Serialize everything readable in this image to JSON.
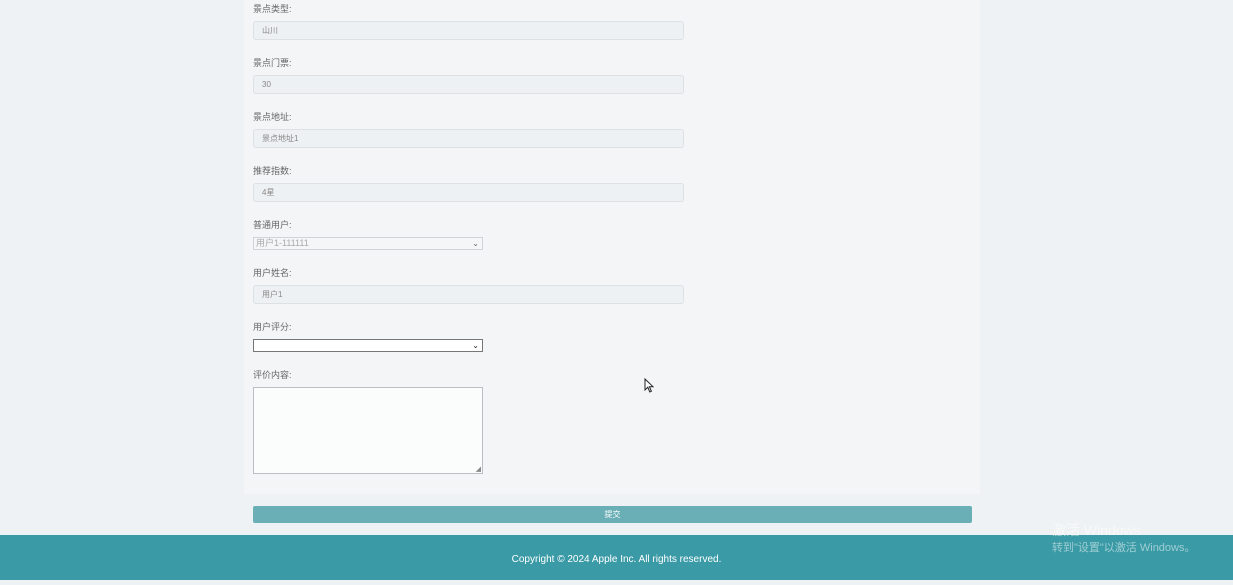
{
  "form": {
    "fields": [
      {
        "label": "景点类型:",
        "value": "山川"
      },
      {
        "label": "景点门票:",
        "value": "30"
      },
      {
        "label": "景点地址:",
        "value": "景点地址1"
      },
      {
        "label": "推荐指数:",
        "value": "4星"
      }
    ],
    "user_select": {
      "label": "普通用户:",
      "value": "用户1-111111"
    },
    "user_name": {
      "label": "用户姓名:",
      "value": "用户1"
    },
    "rating_select": {
      "label": "用户评分:",
      "value": ""
    },
    "comment": {
      "label": "评价内容:",
      "value": ""
    },
    "submit_label": "提交"
  },
  "footer": {
    "copyright": "Copyright © 2024 Apple Inc. All rights reserved."
  },
  "watermark": {
    "line1": "激活 Windows",
    "line2": "转到\"设置\"以激活 Windows。"
  }
}
